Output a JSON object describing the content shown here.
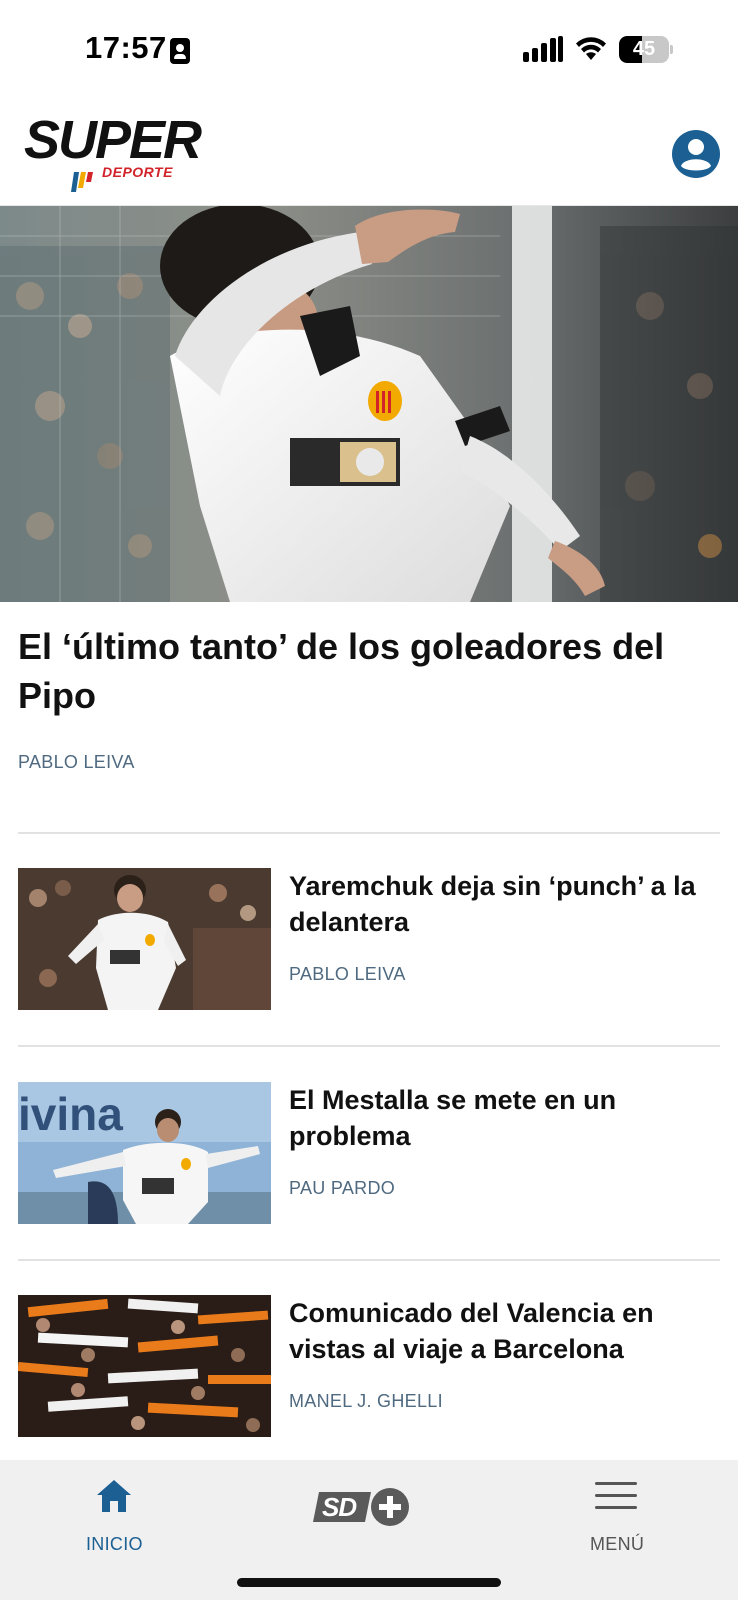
{
  "status_bar": {
    "time": "17:57",
    "battery_level": "45",
    "battery_fraction": 0.45,
    "icons": [
      "id-card-icon",
      "cellular-signal-icon",
      "wifi-icon",
      "battery-icon"
    ]
  },
  "header": {
    "logo_primary": "SUPER",
    "logo_secondary": "DEPORTE",
    "account_icon": "user-account-icon",
    "brand_color": "#1b5f93",
    "logo_accent": "#d2232a"
  },
  "hero": {
    "title": "El ‘último tanto’ de los goleadores del Pipo",
    "author": "PABLO LEIVA"
  },
  "articles": [
    {
      "title": "Yaremchuk deja sin ‘punch’ a la delantera",
      "author": "PABLO LEIVA"
    },
    {
      "title": "El Mestalla se mete en un problema",
      "author": "PAU PARDO"
    },
    {
      "title": "Comunicado del Valencia en vistas al viaje a Barcelona",
      "author": "MANEL J. GHELLI"
    }
  ],
  "bottom_nav": {
    "home_label": "INICIO",
    "home_icon": "home-icon",
    "center_logo": "SD",
    "center_icon": "plus-icon",
    "menu_label": "MENÚ",
    "menu_icon": "hamburger-menu-icon",
    "active_color": "#1b5f93",
    "inactive_color": "#555555"
  },
  "colors": {
    "author_text": "#4f6a80",
    "divider": "#e2e2e2",
    "nav_background": "#f0f0f0"
  }
}
